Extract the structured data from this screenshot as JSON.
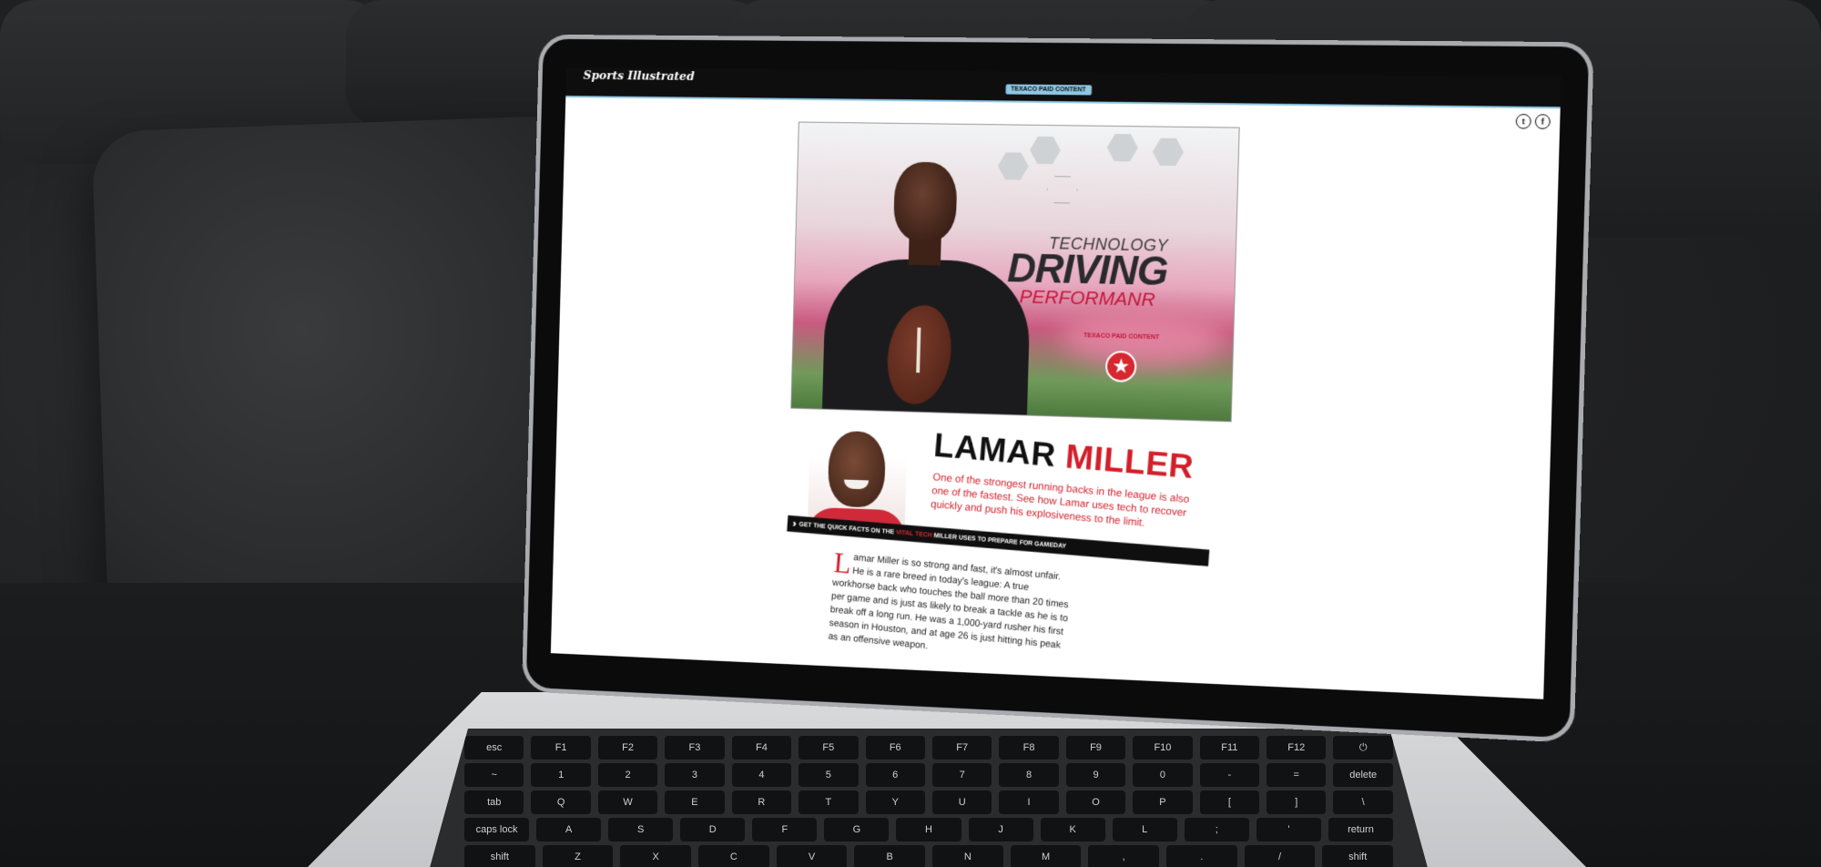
{
  "site": {
    "logo_text": "Sports Illustrated",
    "paid_badge": "TEXACO PAID CONTENT",
    "social": [
      "t",
      "f"
    ]
  },
  "hero": {
    "title_line1": "TECHNOLOGY",
    "title_line2": "DRIVING",
    "title_line3": "PERFORMANR",
    "paid_label": "TEXACO PAID CONTENT"
  },
  "profile": {
    "first_name": "LAMAR",
    "last_name": "MILLER",
    "intro": "One of the strongest running backs in the league is also one of the fastest. See how Lamar uses tech to recover quickly and push his explosiveness to the limit."
  },
  "quick_facts": {
    "prefix": "GET THE QUICK FACTS ON THE",
    "highlight": "VITAL TECH",
    "suffix": "MILLER USES TO PREPARE FOR GAMEDAY"
  },
  "article": {
    "dropcap": "L",
    "body": "amar Miller is so strong and fast, it's almost unfair. He is a rare breed in today's league: A true workhorse back who touches the ball more than 20 times per game and is just as likely to break a tackle as he is to break off a long run. He was a 1,000-yard rusher his first season in Houston, and at age 26 is just hitting his peak as an offensive weapon."
  },
  "keyboard": {
    "row1": [
      "esc",
      "F1",
      "F2",
      "F3",
      "F4",
      "F5",
      "F6",
      "F7",
      "F8",
      "F9",
      "F10",
      "F11",
      "F12",
      "⏻"
    ],
    "row2": [
      "~",
      "1",
      "2",
      "3",
      "4",
      "5",
      "6",
      "7",
      "8",
      "9",
      "0",
      "-",
      "=",
      "delete"
    ],
    "row3": [
      "tab",
      "Q",
      "W",
      "E",
      "R",
      "T",
      "Y",
      "U",
      "I",
      "O",
      "P",
      "[",
      "]",
      "\\"
    ],
    "row4": [
      "caps lock",
      "A",
      "S",
      "D",
      "F",
      "G",
      "H",
      "J",
      "K",
      "L",
      ";",
      "'",
      "return"
    ],
    "row5": [
      "shift",
      "Z",
      "X",
      "C",
      "V",
      "B",
      "N",
      "M",
      ",",
      ".",
      "/",
      "shift"
    ]
  }
}
